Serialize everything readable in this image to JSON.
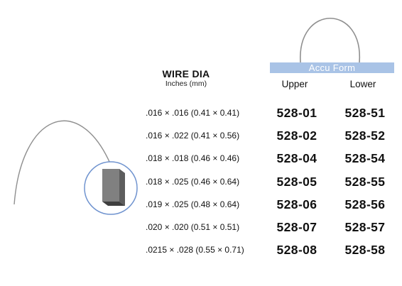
{
  "header": {
    "wire_dia_label": "WIRE DIA",
    "units_label": "Inches (mm)"
  },
  "form": {
    "name": "Accu Form",
    "upper_label": "Upper",
    "lower_label": "Lower",
    "band_color": "#a9c3e6"
  },
  "rows": [
    {
      "dimension": ".016 × .016 (0.41 × 0.41)",
      "upper": "528-01",
      "lower": "528-51"
    },
    {
      "dimension": ".016 × .022 (0.41 × 0.56)",
      "upper": "528-02",
      "lower": "528-52"
    },
    {
      "dimension": ".018 × .018 (0.46 × 0.46)",
      "upper": "528-04",
      "lower": "528-54"
    },
    {
      "dimension": ".018 × .025 (0.46 × 0.64)",
      "upper": "528-05",
      "lower": "528-55"
    },
    {
      "dimension": ".019 × .025 (0.48 × 0.64)",
      "upper": "528-06",
      "lower": "528-56"
    },
    {
      "dimension": ".020 × .020 (0.51 × 0.51)",
      "upper": "528-07",
      "lower": "528-57"
    },
    {
      "dimension": ".0215 × .028 (0.55 × 0.71)",
      "upper": "528-08",
      "lower": "528-58"
    }
  ],
  "icons": {
    "arch": "archwire-arch-icon",
    "wire_curve": "wire-curve-icon",
    "cross_section": "wire-cross-section-icon"
  }
}
